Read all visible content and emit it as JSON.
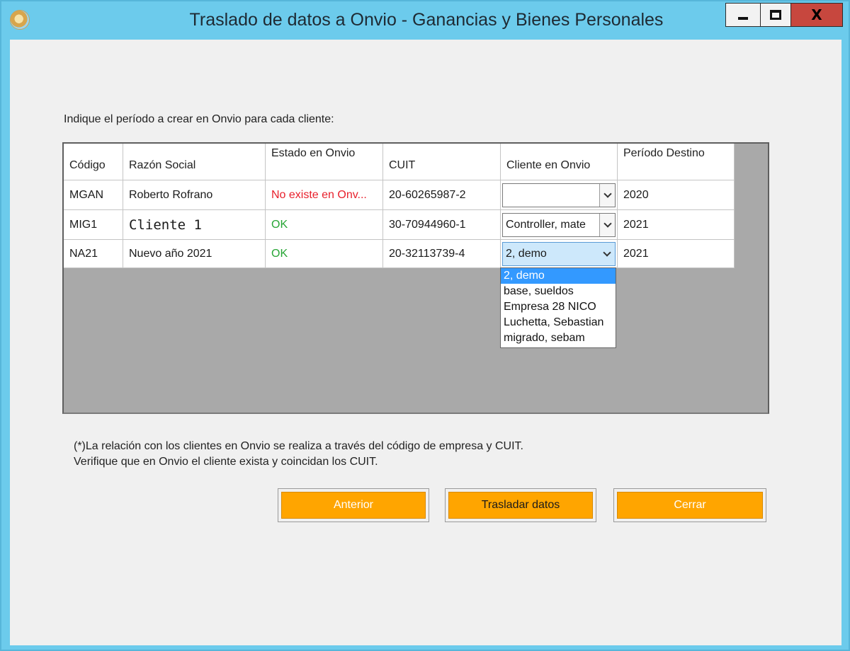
{
  "window": {
    "title": "Traslado de datos a Onvio - Ganancias y Bienes Personales",
    "close_glyph": "X"
  },
  "instruction": "Indique el período a crear en Onvio para cada cliente:",
  "table": {
    "headers": {
      "codigo": "Código",
      "razon": "Razón Social",
      "estado": "Estado en Onvio",
      "cuit": "CUIT",
      "cliente": "Cliente en Onvio",
      "periodo": "Período Destino"
    },
    "rows": [
      {
        "codigo": "MGAN",
        "razon": "Roberto Rofrano",
        "estado": "No existe en Onv...",
        "cuit": "20-60265987-2",
        "cliente": "",
        "periodo": "2020"
      },
      {
        "codigo": "MIG1",
        "razon": "Cliente 1",
        "estado": "OK",
        "cuit": "30-70944960-1",
        "cliente": "Controller, mate",
        "periodo": "2021"
      },
      {
        "codigo": "NA21",
        "razon": "Nuevo año 2021",
        "estado": "OK",
        "cuit": "20-32113739-4",
        "cliente": "2, demo",
        "periodo": "2021"
      }
    ]
  },
  "dropdown": {
    "options": [
      "2, demo",
      "base, sueldos",
      "Empresa 28 NICO",
      "Luchetta, Sebastian",
      "migrado, sebam"
    ]
  },
  "note": {
    "line1": "(*)La relación con los clientes en Onvio se realiza a través del código de empresa y CUIT.",
    "line2": "Verifique que en Onvio el cliente exista y coincidan los CUIT."
  },
  "buttons": {
    "anterior": "Anterior",
    "trasladar": "Trasladar datos",
    "cerrar": "Cerrar"
  },
  "colors": {
    "accent": "#ffa500",
    "window_frame": "#6ccbec",
    "status_error": "#e8202c",
    "status_ok": "#27a535"
  }
}
